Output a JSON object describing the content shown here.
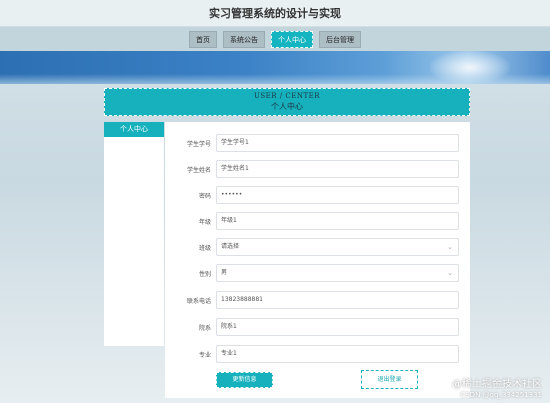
{
  "header": {
    "title": "实习管理系统的设计与实现"
  },
  "nav": {
    "items": [
      {
        "label": "首页"
      },
      {
        "label": "系统公告"
      },
      {
        "label": "个人中心"
      },
      {
        "label": "后台管理"
      }
    ]
  },
  "user_center": {
    "title_en": "USER / CENTER",
    "title_cn": "个人中心"
  },
  "sidebar": {
    "items": [
      {
        "label": "个人中心"
      }
    ]
  },
  "form": {
    "fields": [
      {
        "label": "学生学号",
        "value": "学生学号1"
      },
      {
        "label": "学生姓名",
        "value": "学生姓名1"
      },
      {
        "label": "密码",
        "value": "••••••"
      },
      {
        "label": "年级",
        "value": "年级1"
      },
      {
        "label": "班级",
        "value": "请选择"
      },
      {
        "label": "性别",
        "value": "男"
      },
      {
        "label": "联系电话",
        "value": "13823888881"
      },
      {
        "label": "院系",
        "value": "院系1"
      },
      {
        "label": "专业",
        "value": "专业1"
      }
    ],
    "update_label": "更新信息",
    "logout_label": "退出登录"
  },
  "watermark": {
    "text": "@稀土掘金技术社区",
    "sub": "CSDN @qq_334251331"
  },
  "colors": {
    "accent": "#16b1bd",
    "nav": "#c3d5dc"
  }
}
